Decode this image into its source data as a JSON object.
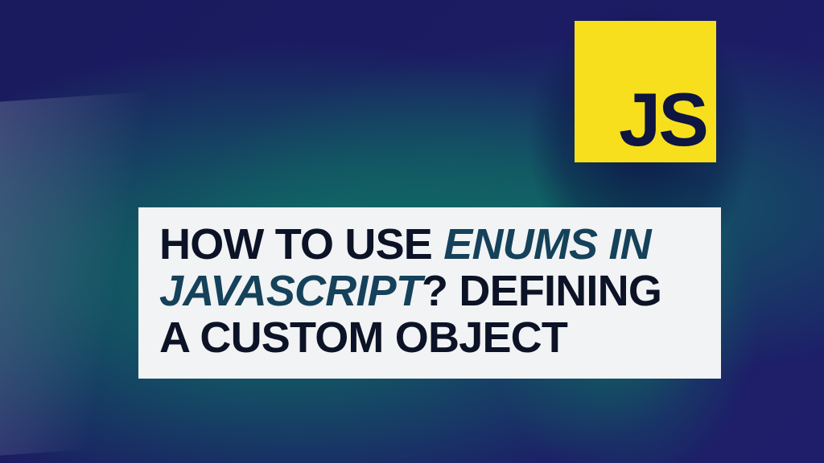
{
  "logo": {
    "text": "JS"
  },
  "title": {
    "part1": "HOW TO USE ",
    "accent": "ENUMS IN JAVASCRIPT",
    "part2": "? DEFINING A CUSTOM OBJECT"
  },
  "colors": {
    "background": "#1a1a5e",
    "logo_bg": "#f7df1e",
    "logo_text": "#0d1540",
    "title_bg": "#f1f3f4",
    "title_text": "#0d1326",
    "accent_text": "#15415a"
  }
}
